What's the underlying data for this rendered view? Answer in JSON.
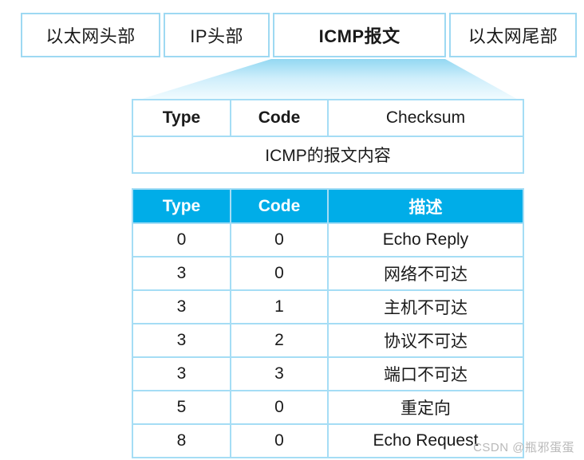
{
  "frame_bar": {
    "cells": [
      {
        "label": "以太网头部",
        "emphasis": false
      },
      {
        "label": "IP头部",
        "emphasis": false
      },
      {
        "label": "ICMP报文",
        "emphasis": true
      },
      {
        "label": "以太网尾部",
        "emphasis": false
      }
    ]
  },
  "connector": {
    "shape": "trapezoid-funnel",
    "gradient_top": "#9edcf4",
    "gradient_bottom": "#f4fcfe"
  },
  "icmp_format_table": {
    "header_cells": [
      "Type",
      "Code",
      "Checksum"
    ],
    "payload_cell": "ICMP的报文内容"
  },
  "icmp_types_table": {
    "columns": [
      "Type",
      "Code",
      "描述"
    ],
    "rows": [
      {
        "type": "0",
        "code": "0",
        "desc": "Echo Reply"
      },
      {
        "type": "3",
        "code": "0",
        "desc": "网络不可达"
      },
      {
        "type": "3",
        "code": "1",
        "desc": "主机不可达"
      },
      {
        "type": "3",
        "code": "2",
        "desc": "协议不可达"
      },
      {
        "type": "3",
        "code": "3",
        "desc": "端口不可达"
      },
      {
        "type": "5",
        "code": "0",
        "desc": "重定向"
      },
      {
        "type": "8",
        "code": "0",
        "desc": "Echo  Request"
      }
    ]
  },
  "colors": {
    "header_blue": "#00ade8",
    "border_blue": "#a5ddf5",
    "frame_border": "#9ed9f2"
  },
  "watermark": {
    "text": "CSDN @瓶邪蛋蛋"
  }
}
